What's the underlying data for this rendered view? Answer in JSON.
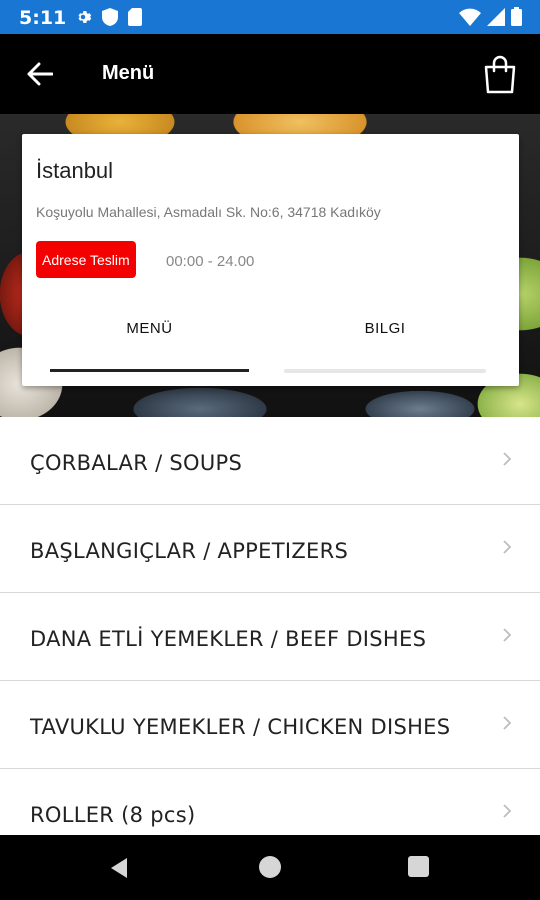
{
  "status_bar": {
    "time": "5:11",
    "left_icons": [
      "settings-icon",
      "shield-icon",
      "sim-card-icon"
    ],
    "right_icons": [
      "wifi-icon",
      "signal-icon",
      "battery-icon"
    ],
    "background": "#1976d2"
  },
  "app_bar": {
    "title": "Menü",
    "back_icon": "arrow-left-icon",
    "cart_icon": "shopping-bag-icon"
  },
  "restaurant": {
    "name": "İstanbul",
    "address": "Koşuyolu Mahallesi, Asmadalı Sk. No:6, 34718 Kadıköy",
    "delivery_label": "Adrese Teslim",
    "hours": "00:00 - 24.00"
  },
  "tabs": [
    {
      "label": "MENÜ",
      "active": true
    },
    {
      "label": "BILGI",
      "active": false
    }
  ],
  "menu_items": [
    {
      "label": "ÇORBALAR / SOUPS"
    },
    {
      "label": "BAŞLANGIÇLAR / APPETIZERS"
    },
    {
      "label": "DANA ETLİ YEMEKLER / BEEF DISHES"
    },
    {
      "label": "TAVUKLU YEMEKLER / CHICKEN DISHES"
    },
    {
      "label": "ROLLER (8 pcs)"
    }
  ],
  "colors": {
    "accent_red": "#f40000",
    "app_bar": "#000000"
  }
}
